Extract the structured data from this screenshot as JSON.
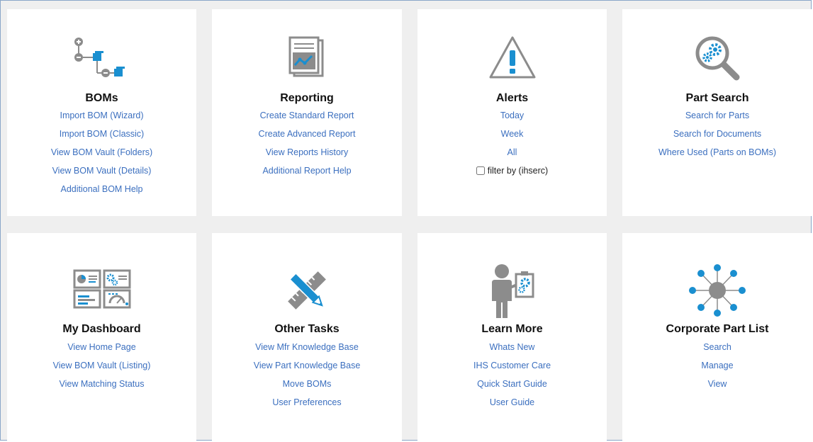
{
  "tiles": {
    "boms": {
      "title": "BOMs",
      "links": [
        "Import BOM (Wizard)",
        "Import BOM (Classic)",
        "View BOM Vault (Folders)",
        "View BOM Vault (Details)",
        "Additional BOM Help"
      ]
    },
    "reporting": {
      "title": "Reporting",
      "links": [
        "Create Standard Report",
        "Create Advanced Report",
        "View Reports History",
        "Additional Report Help"
      ]
    },
    "alerts": {
      "title": "Alerts",
      "links": [
        "Today",
        "Week",
        "All"
      ],
      "filter_label": "filter by (ihserc)"
    },
    "part_search": {
      "title": "Part Search",
      "links": [
        "Search for Parts",
        "Search for Documents",
        "Where Used (Parts on BOMs)"
      ]
    },
    "dashboard": {
      "title": "My Dashboard",
      "links": [
        "View Home Page",
        "View BOM Vault (Listing)",
        "View Matching Status"
      ]
    },
    "other_tasks": {
      "title": "Other Tasks",
      "links": [
        "View Mfr Knowledge Base",
        "View Part Knowledge Base",
        "Move BOMs",
        "User Preferences"
      ]
    },
    "learn_more": {
      "title": "Learn More",
      "links": [
        "Whats New",
        "IHS Customer Care",
        "Quick Start Guide",
        "User Guide"
      ]
    },
    "corporate_part_list": {
      "title": "Corporate Part List",
      "links": [
        "Search",
        "Manage",
        "View"
      ]
    }
  },
  "colors": {
    "accent_blue": "#1a8fd0",
    "icon_gray": "#8c8c8c",
    "link": "#3b6fbf",
    "panel_bg": "#efefef"
  }
}
